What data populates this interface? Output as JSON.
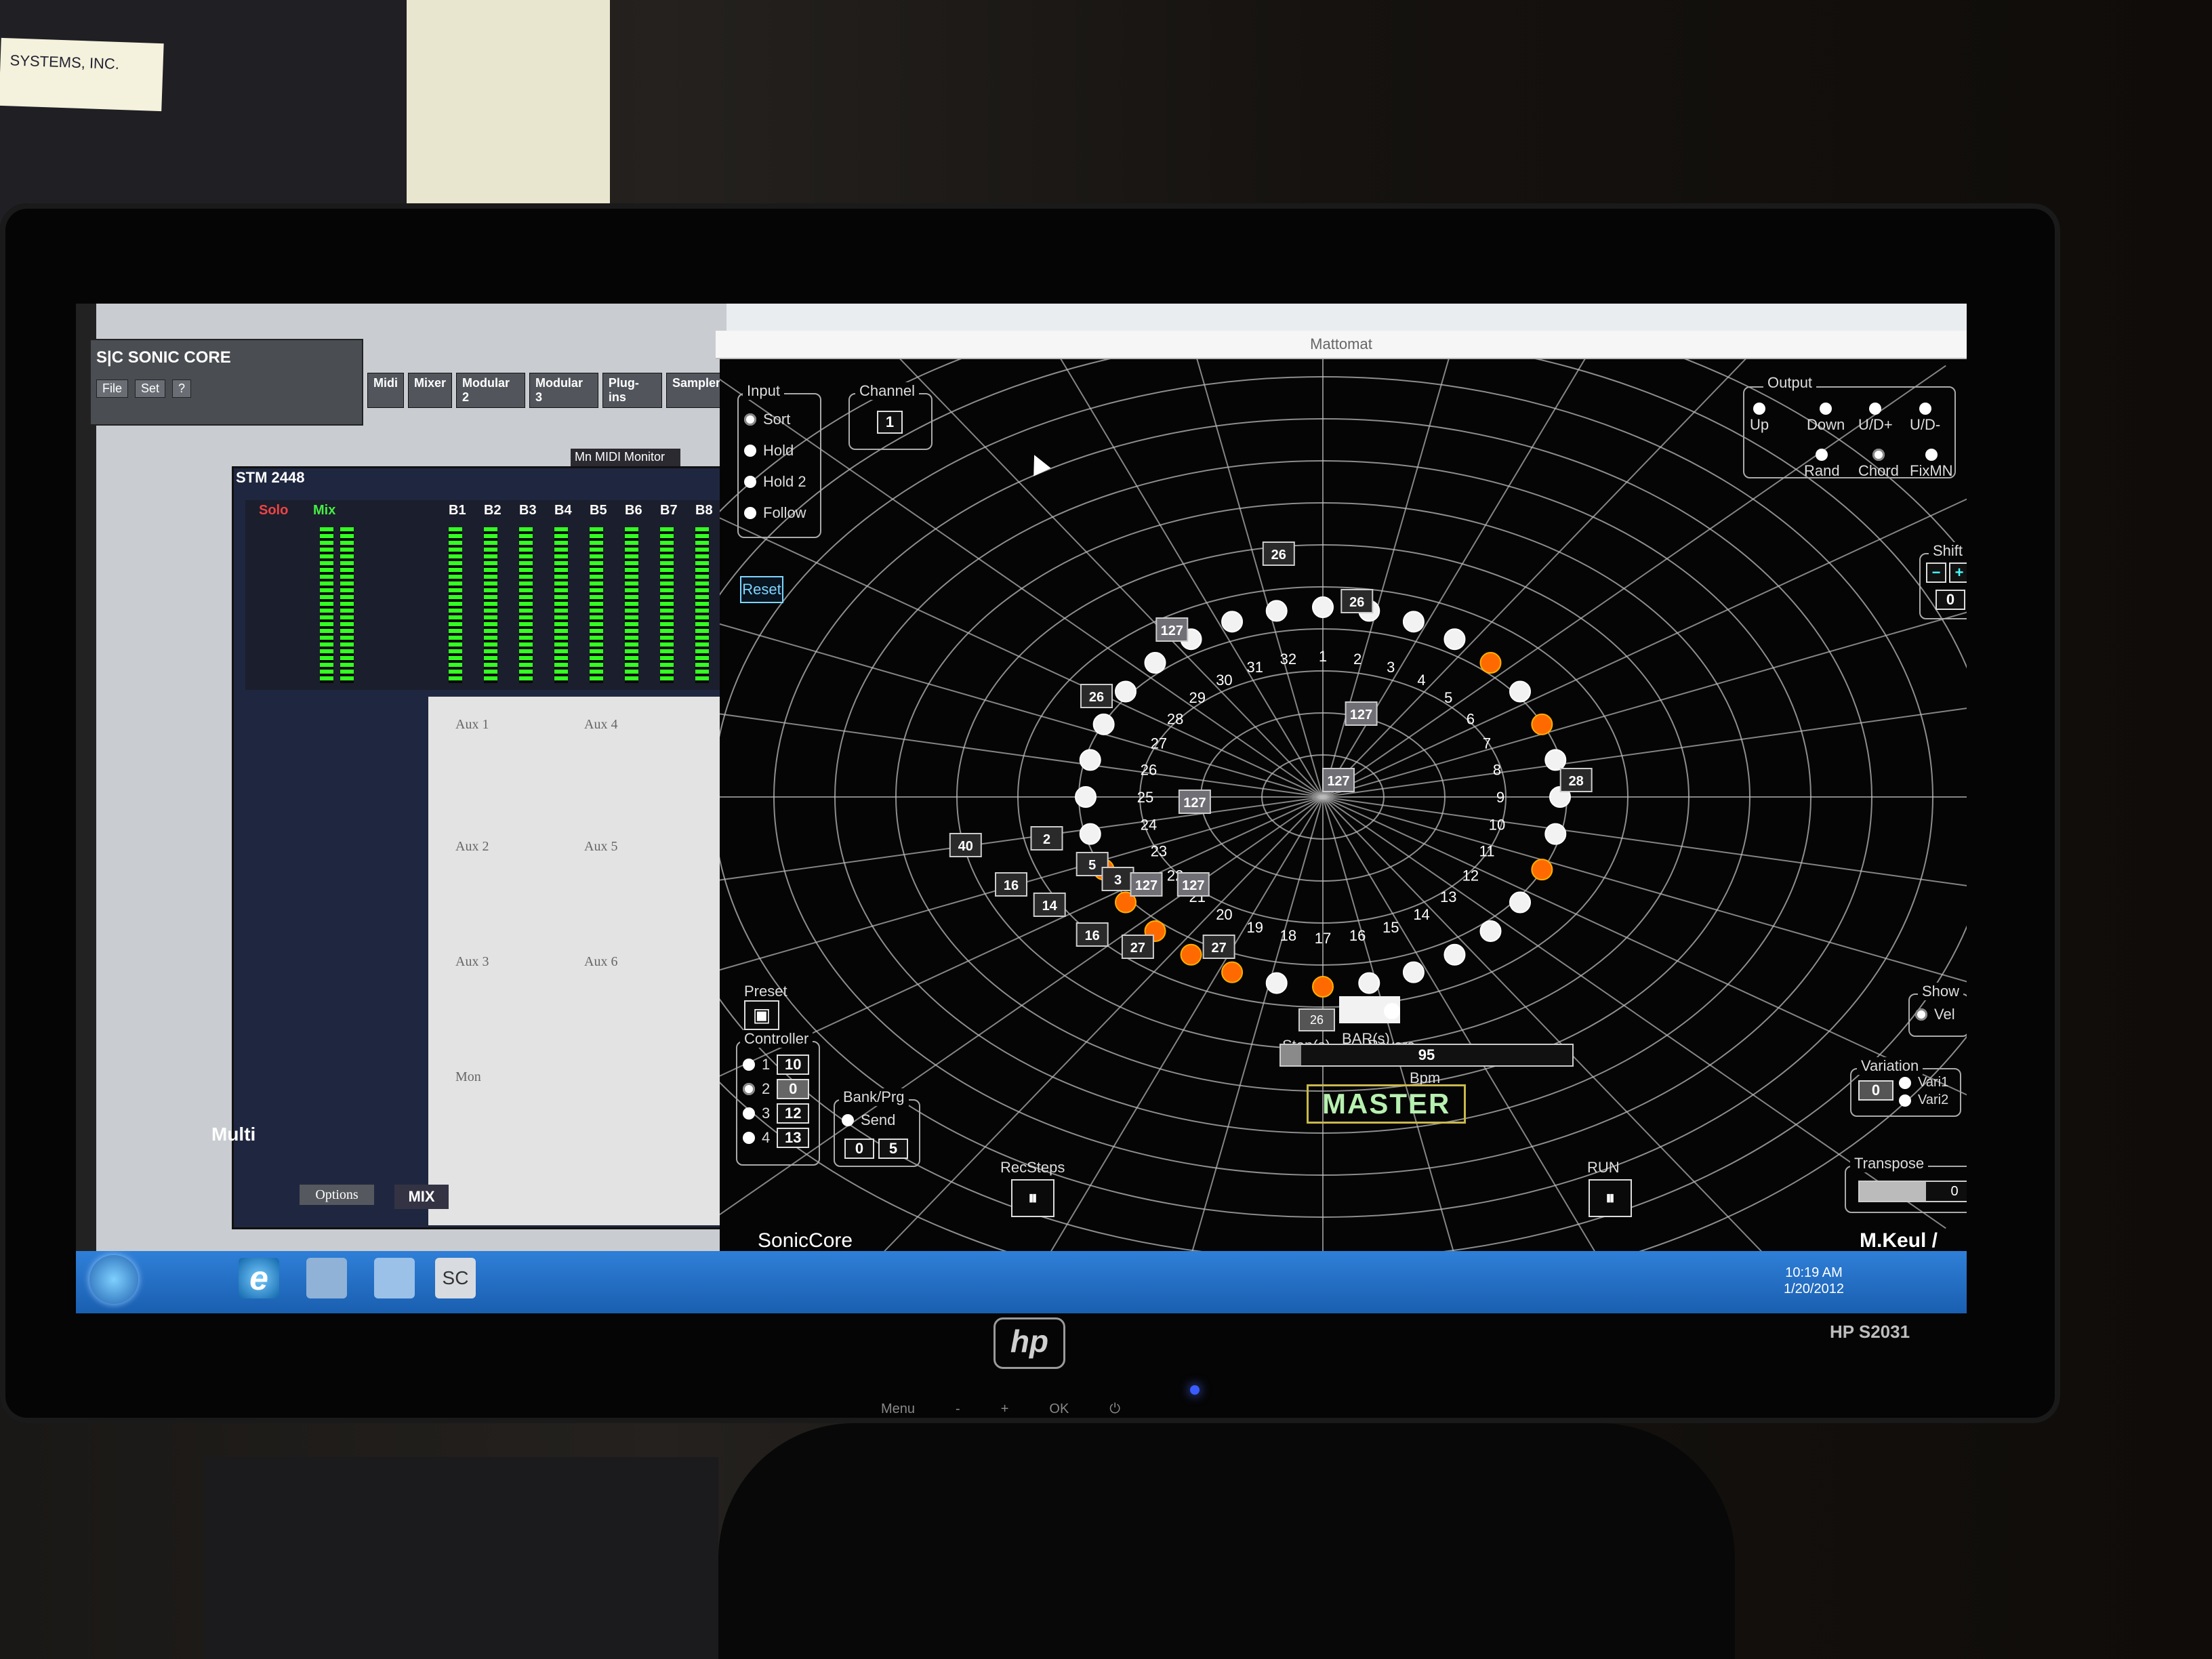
{
  "room": {
    "sign_text": "SYSTEMS, INC.",
    "monitor_brand": "hp",
    "monitor_model": "HP S2031",
    "front_controls": [
      "Menu",
      "-",
      "+",
      "OK",
      "⏻"
    ]
  },
  "left_app": {
    "title": "S|C SONIC CORE",
    "menu": [
      "File",
      "Set",
      "?"
    ],
    "module_tabs": [
      "Midi",
      "Mixer",
      "Modular 2",
      "Modular 3",
      "Plug-ins",
      "Sampler"
    ],
    "midi_monitor": "Mn MIDI Monitor",
    "stm_title": "STM 2448",
    "meter_labels": [
      "Solo",
      "Mix",
      "B1",
      "B2",
      "B3",
      "B4",
      "B5",
      "B6",
      "B7",
      "B8"
    ],
    "aux_labels": [
      "Aux 1",
      "Aux 4",
      "Aux 2",
      "Aux 5",
      "Aux 3",
      "Aux 6",
      "Mon"
    ],
    "options_label": "Options",
    "mix_label": "MIX",
    "multi_label": "Multi"
  },
  "taskbar": {
    "sc_label": "SC",
    "clock_time": "10:19 AM",
    "clock_date": "1/20/2012"
  },
  "mattomat": {
    "window_title": "Mattomat",
    "input": {
      "title": "Input",
      "options": [
        "Sort",
        "Hold",
        "Hold 2",
        "Follow"
      ],
      "selected": "Sort"
    },
    "channel": {
      "title": "Channel",
      "value": "1"
    },
    "reset_label": "Reset",
    "output": {
      "title": "Output",
      "options_row1": [
        "Up",
        "Down",
        "U/D+",
        "U/D-"
      ],
      "options_row2": [
        "Rand",
        "Chord",
        "FixMN"
      ],
      "selected": "Chord"
    },
    "shift": {
      "title": "Shift",
      "minus": "−",
      "plus": "+",
      "value": "0"
    },
    "step_labels": [
      "1",
      "2",
      "3",
      "4",
      "5",
      "6",
      "7",
      "8",
      "9",
      "10",
      "11",
      "12",
      "13",
      "14",
      "15",
      "16",
      "17",
      "18",
      "19",
      "20",
      "21",
      "22",
      "23",
      "24",
      "25",
      "26",
      "27",
      "28",
      "29",
      "30",
      "31",
      "32"
    ],
    "step_count_label": "Step(s)",
    "step_value": "26",
    "bars_label": "BAR(s)",
    "revers_label": "Revers",
    "bpm_value": "95",
    "bpm_fill": 0.07,
    "bpm_label": "Bpm",
    "master_label": "MASTER",
    "preset_label": "Preset",
    "controller": {
      "title": "Controller",
      "rows": [
        {
          "num": "1",
          "value": "10"
        },
        {
          "num": "2",
          "value": "0"
        },
        {
          "num": "3",
          "value": "12"
        },
        {
          "num": "4",
          "value": "13"
        }
      ],
      "selected": "2"
    },
    "bank_prg": {
      "title": "Bank/Prg",
      "send_label": "Send",
      "bank": "0",
      "prg": "5"
    },
    "recsteps_label": "RecSteps",
    "run_label": "RUN",
    "show": {
      "title": "Show",
      "vel_label": "Vel"
    },
    "variation": {
      "title": "Variation",
      "options": [
        "Vari1",
        "Vari2"
      ],
      "value": "0"
    },
    "transpose": {
      "title": "Transpose",
      "value": "0",
      "fill": 0.35
    },
    "brand": "SonicCore",
    "author": "M.Keul / G.O.S.T.",
    "velocity_boxes": [
      "26",
      "127",
      "26",
      "127",
      "26",
      "127",
      "28",
      "127",
      "40",
      "2",
      "5",
      "3",
      "127",
      "127",
      "16",
      "14",
      "16",
      "27",
      "27"
    ],
    "active_step_color": "#ff6a00",
    "inactive_step_color": "#f2f2f2"
  }
}
